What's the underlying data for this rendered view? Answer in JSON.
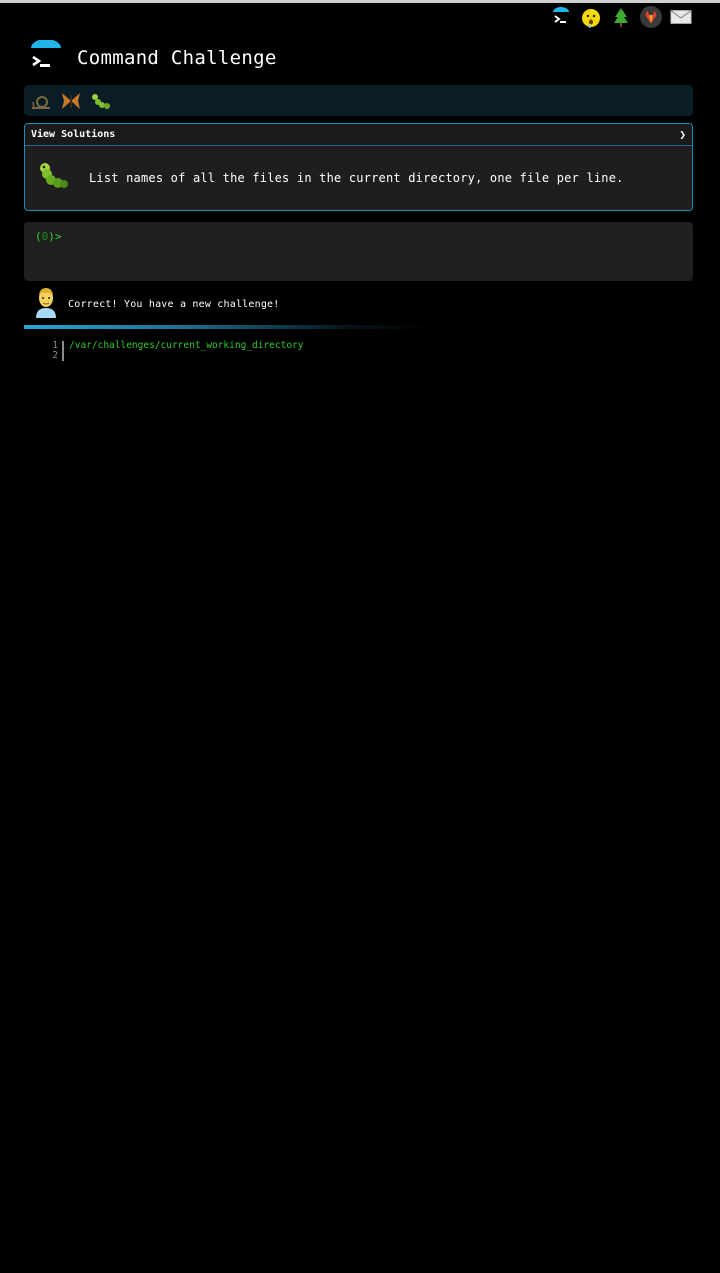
{
  "app": {
    "title": "Command Challenge"
  },
  "top_nav": {
    "icons": [
      {
        "name": "home-logo-icon"
      },
      {
        "name": "mind-blown-emoji-icon",
        "glyph": "🤯"
      },
      {
        "name": "tree-icon",
        "glyph": "🌲"
      },
      {
        "name": "gitlab-icon"
      },
      {
        "name": "mail-icon"
      }
    ]
  },
  "badges": [
    {
      "name": "snail-badge-icon",
      "glyph": "🐌"
    },
    {
      "name": "butterfly-badge-icon",
      "glyph": "🦋"
    },
    {
      "name": "caterpillar-badge-icon",
      "glyph": "🐛"
    }
  ],
  "challenge": {
    "solutions_label": "View Solutions",
    "chevron": "❯",
    "icon": "caterpillar-icon",
    "description": "List names of all the files in the current directory, one file per line."
  },
  "terminal": {
    "prompt_open": "(",
    "prompt_num": "0",
    "prompt_close": ")>"
  },
  "feedback": {
    "icon": "person-avatar-icon",
    "message": "Correct! You have a new challenge!"
  },
  "output": {
    "lines": [
      {
        "num": "1",
        "text": "/var/challenges/current_working_directory"
      },
      {
        "num": "2",
        "text": ""
      }
    ]
  },
  "colors": {
    "accent": "#1a8fb5",
    "prompt_green": "#2fd92f",
    "output_green": "#2fc92f",
    "badge_bar_bg": "#0a1d26"
  }
}
